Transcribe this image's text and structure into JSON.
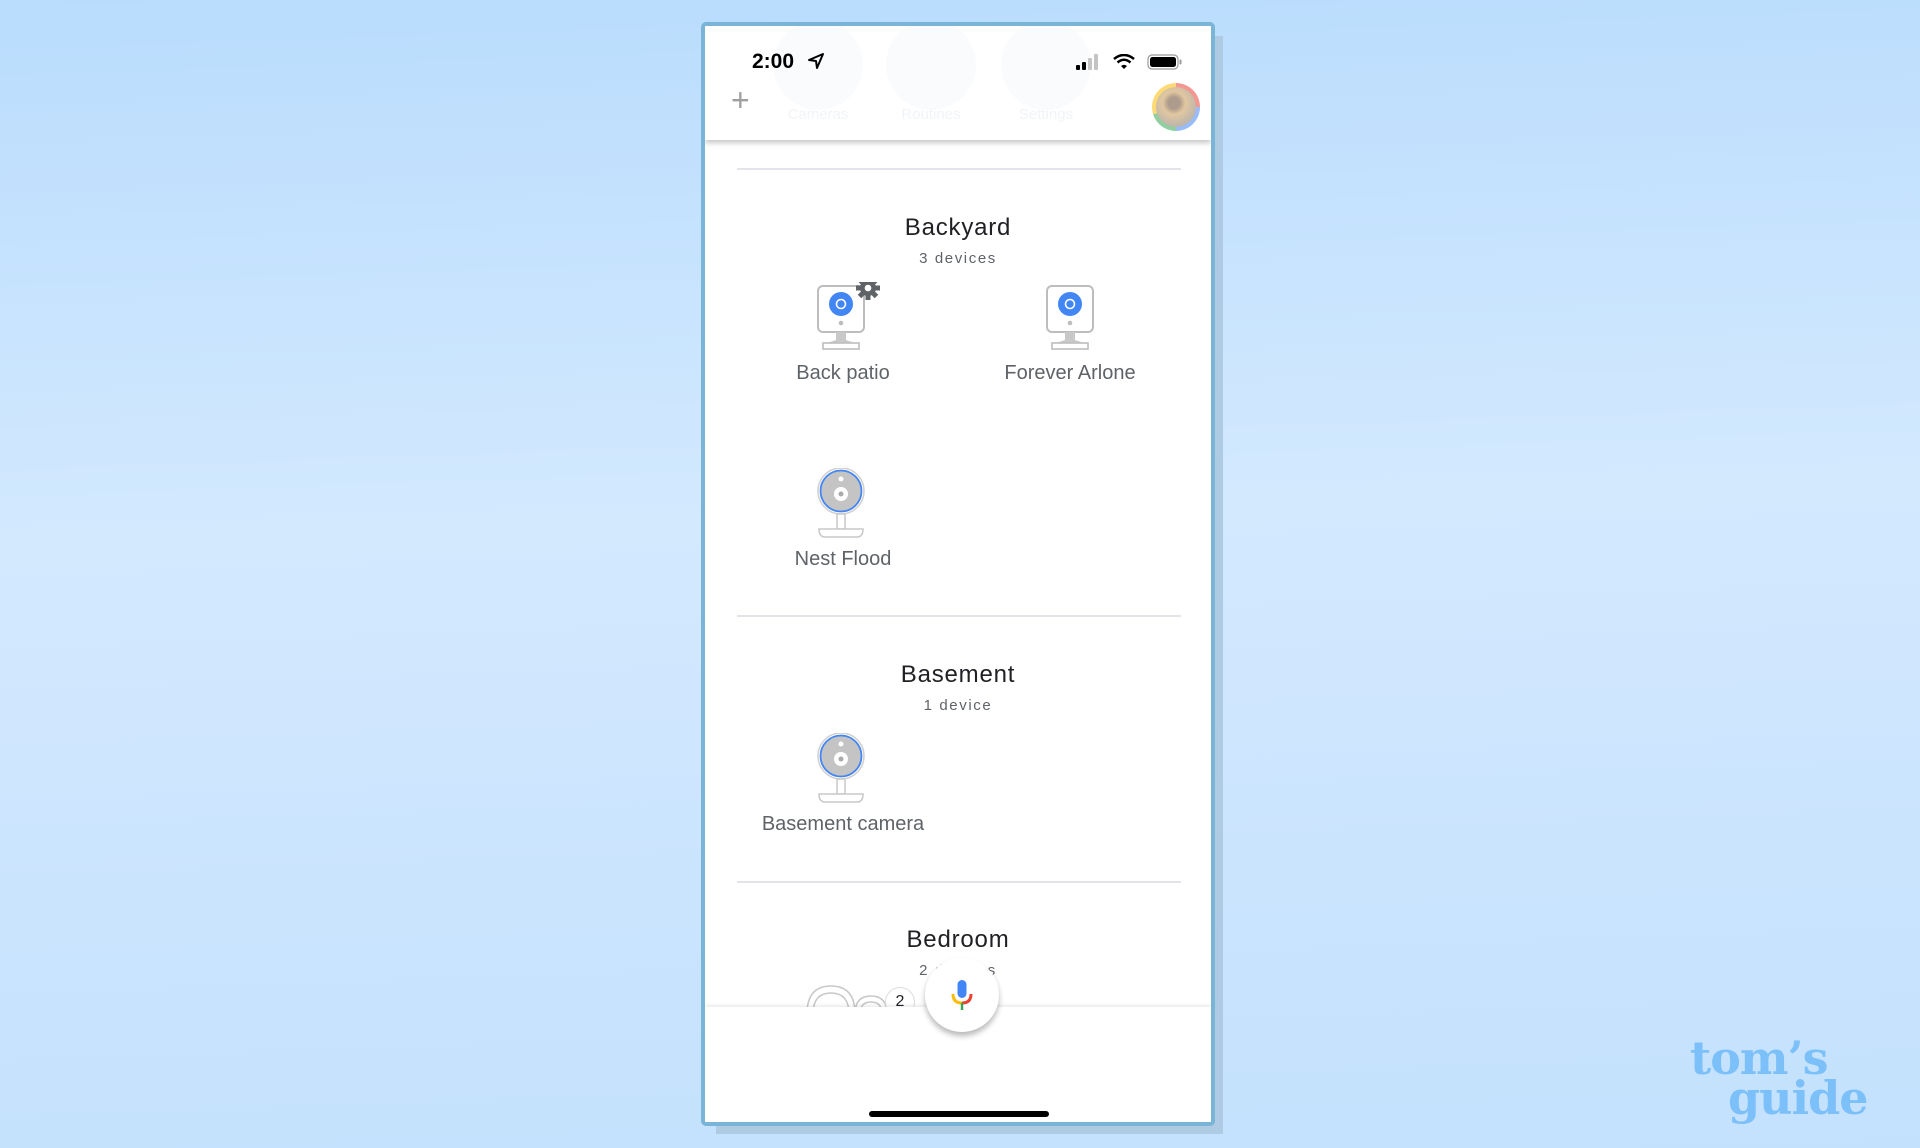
{
  "status_bar": {
    "time": "2:00",
    "location_icon": "location-arrow-icon",
    "signal_icon": "cellular-signal-icon",
    "wifi_icon": "wifi-icon",
    "battery_icon": "battery-icon"
  },
  "header": {
    "add_icon": "plus-icon",
    "tabs": [
      {
        "label": "Cameras",
        "icon": "video-camera-icon"
      },
      {
        "label": "Routines",
        "icon": "routines-icon"
      },
      {
        "label": "Settings",
        "icon": "gear-icon"
      }
    ],
    "avatar": "profile-avatar"
  },
  "rooms": [
    {
      "name": "Backyard",
      "count": "3 devices",
      "devices": [
        {
          "label": "Back patio",
          "icon": "indoor-camera-icon",
          "settings_badge": true
        },
        {
          "label": "Forever Arlone",
          "icon": "indoor-camera-icon"
        },
        {
          "label": "Nest Flood",
          "icon": "round-camera-icon"
        }
      ]
    },
    {
      "name": "Basement",
      "count": "1 device",
      "devices": [
        {
          "label": "Basement camera",
          "icon": "round-camera-icon"
        }
      ]
    },
    {
      "name": "Bedroom",
      "count": "2 devices",
      "devices_group": {
        "icon": "speaker-group-icon",
        "badge": "2"
      }
    }
  ],
  "bottom_nav": {
    "home": "home-icon",
    "mic": "microphone-icon",
    "feed": "feed-icon"
  },
  "colors": {
    "accent": "#1a73e8",
    "camera_blue": "#4285f4",
    "frame": "#7ab5d8"
  },
  "watermark": {
    "line1": "tom’s",
    "line2": "guide"
  }
}
